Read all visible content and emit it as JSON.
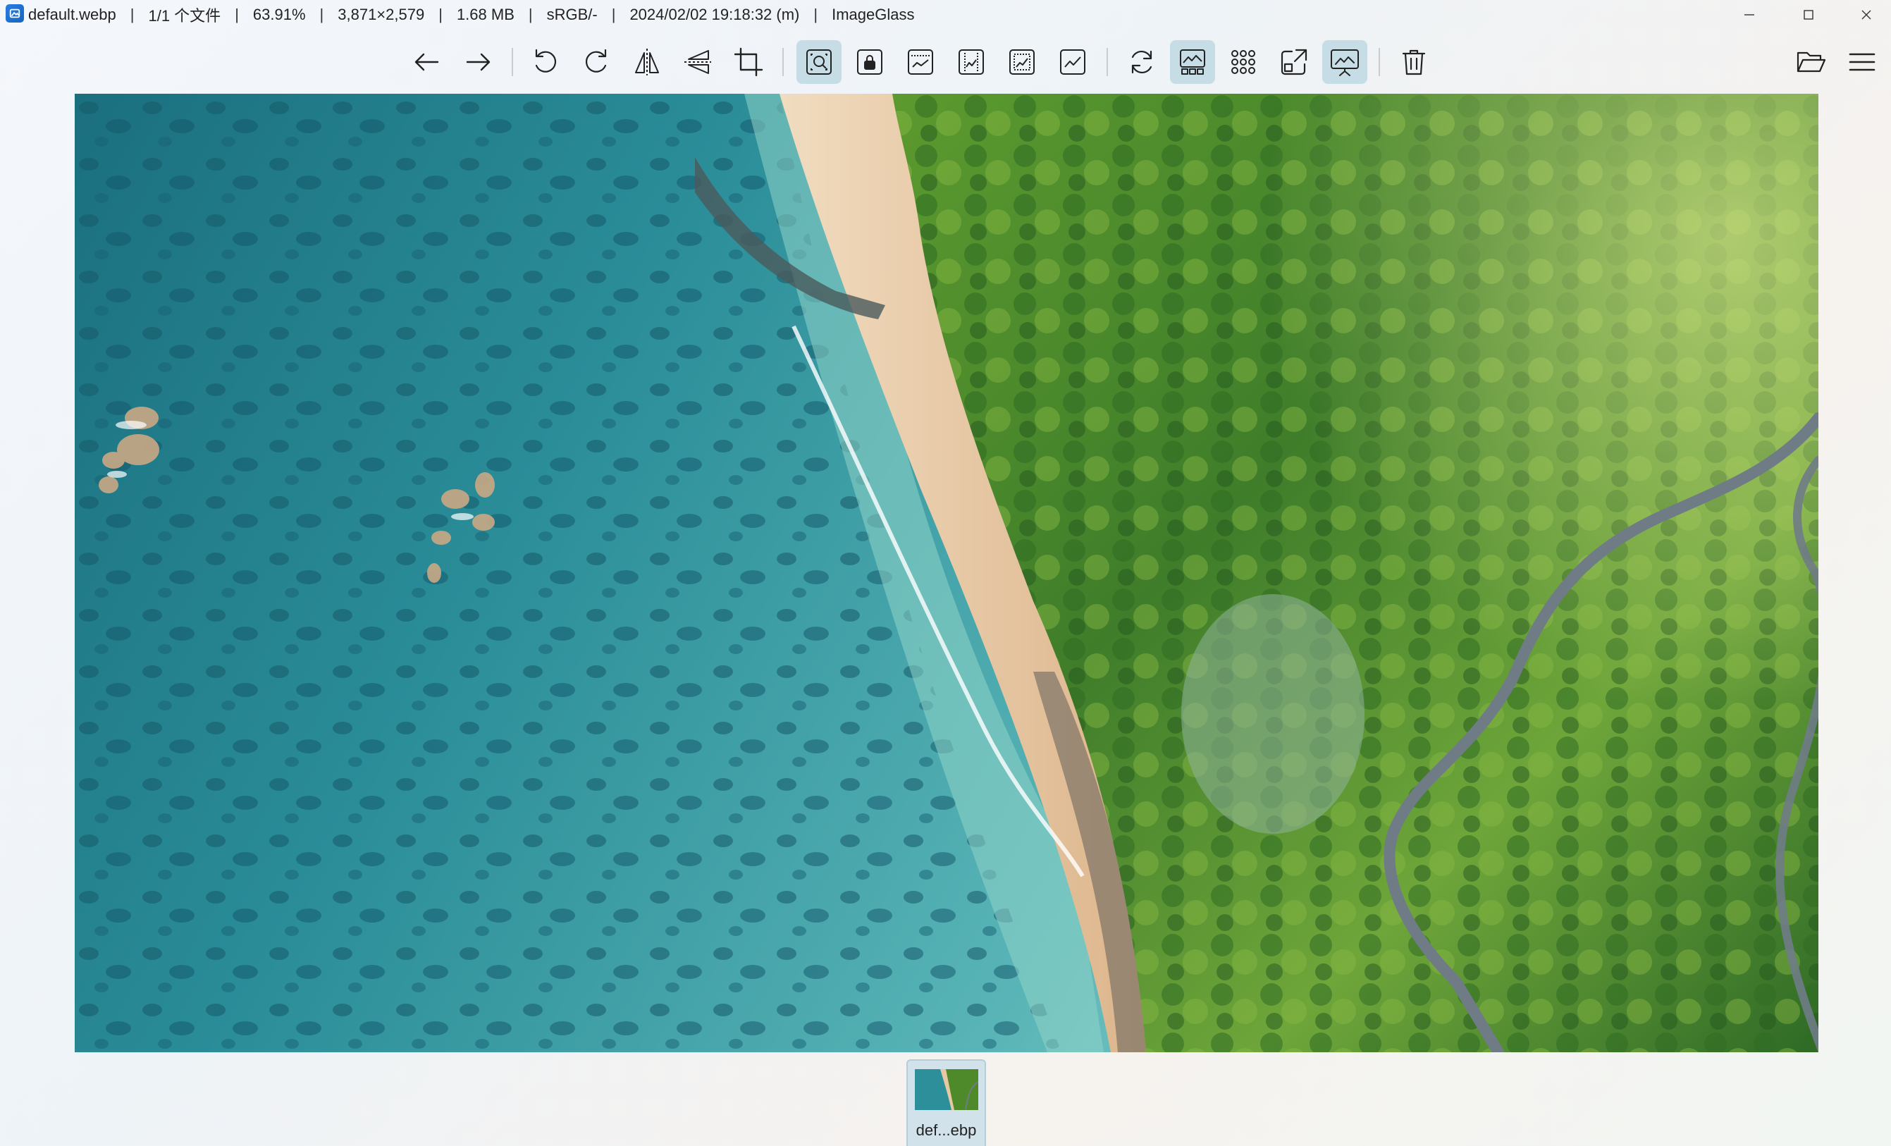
{
  "window": {
    "filename": "default.webp",
    "file_index": "1/1 个文件",
    "zoom": "63.91%",
    "dimensions": "3,871×2,579",
    "filesize": "1.68 MB",
    "color_profile": "sRGB/-",
    "datetime": "2024/02/02 19:18:32 (m)",
    "app_name": "ImageGlass",
    "separator": "|"
  },
  "toolbar": {
    "buttons": [
      {
        "name": "previous-image",
        "icon": "arrow-left-icon",
        "active": false
      },
      {
        "name": "next-image",
        "icon": "arrow-right-icon",
        "active": false
      },
      {
        "name": "rotate-left",
        "icon": "rotate-left-icon",
        "active": false
      },
      {
        "name": "rotate-right",
        "icon": "rotate-right-icon",
        "active": false
      },
      {
        "name": "flip-horizontal",
        "icon": "flip-horizontal-icon",
        "active": false
      },
      {
        "name": "flip-vertical",
        "icon": "flip-vertical-icon",
        "active": false
      },
      {
        "name": "crop",
        "icon": "crop-icon",
        "active": false
      },
      {
        "name": "auto-zoom",
        "icon": "auto-zoom-icon",
        "active": true
      },
      {
        "name": "lock-zoom",
        "icon": "lock-zoom-icon",
        "active": false
      },
      {
        "name": "scale-to-width",
        "icon": "scale-width-icon",
        "active": false
      },
      {
        "name": "scale-to-height",
        "icon": "scale-height-icon",
        "active": false
      },
      {
        "name": "scale-to-fit",
        "icon": "scale-fit-icon",
        "active": false
      },
      {
        "name": "scale-to-fill",
        "icon": "scale-fill-icon",
        "active": false
      },
      {
        "name": "refresh",
        "icon": "refresh-icon",
        "active": false
      },
      {
        "name": "gallery",
        "icon": "gallery-icon",
        "active": true
      },
      {
        "name": "checkerboard",
        "icon": "grid-dots-icon",
        "active": false
      },
      {
        "name": "full-screen",
        "icon": "fullscreen-icon",
        "active": false
      },
      {
        "name": "slideshow",
        "icon": "slideshow-icon",
        "active": true
      },
      {
        "name": "delete",
        "icon": "trash-icon",
        "active": false
      },
      {
        "name": "open-file",
        "icon": "folder-open-icon",
        "active": false
      },
      {
        "name": "main-menu",
        "icon": "hamburger-menu-icon",
        "active": false
      }
    ],
    "active_color": "#c7dde6"
  },
  "thumbnails": [
    {
      "label": "def...ebp",
      "selected": true
    }
  ],
  "colors": {
    "ocean_deep": "#1f7f8c",
    "ocean_shallow": "#6fc4c6",
    "sand": "#e8c9a4",
    "forest": "#4f8a2a",
    "road": "#6f7c86"
  }
}
